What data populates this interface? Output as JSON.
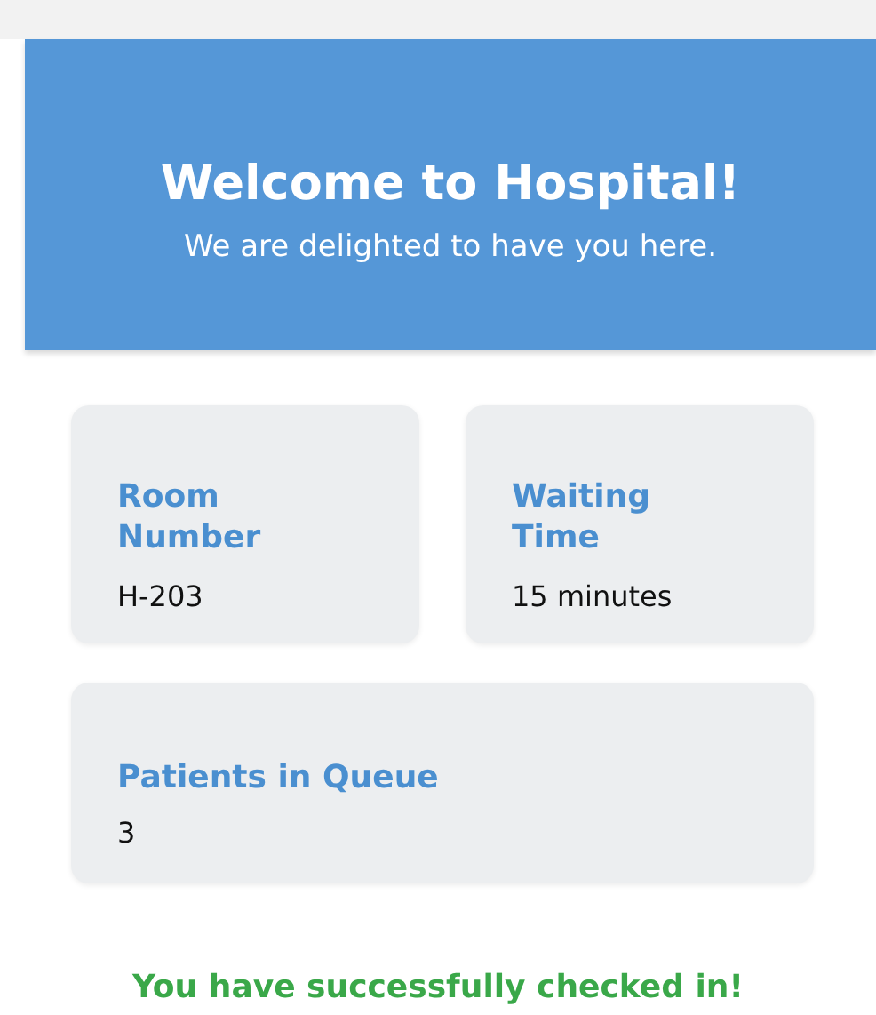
{
  "header": {
    "title": "Welcome to Hospital!",
    "subtitle": "We are delighted to have you here."
  },
  "cards": [
    {
      "label": "Room Number",
      "value": "H-203"
    },
    {
      "label": "Waiting Time",
      "value": "15 minutes"
    },
    {
      "label": "Patients in Queue",
      "value": "3"
    }
  ],
  "status": "You have successfully checked in!"
}
